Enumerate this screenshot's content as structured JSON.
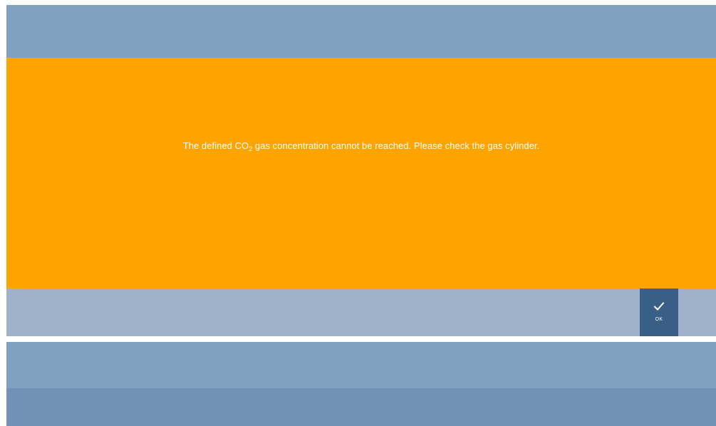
{
  "alert": {
    "message_before": "The defined CO",
    "message_subscript": "2",
    "message_after": " gas concentration cannot be reached. Please check the gas cylinder.",
    "background_color": "#fea400"
  },
  "actions": {
    "ok_label": "OK",
    "ok_icon": "checkmark-icon",
    "button_color": "#3a5f86"
  },
  "theme": {
    "header_color": "#7fa2c1",
    "button_bar_color": "#9eb3c9",
    "footer_color": "#7093b5"
  }
}
